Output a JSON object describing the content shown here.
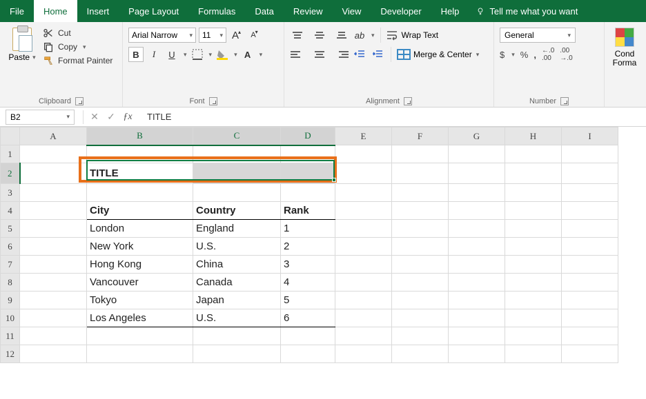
{
  "tabs": {
    "file": "File",
    "home": "Home",
    "insert": "Insert",
    "pageLayout": "Page Layout",
    "formulas": "Formulas",
    "data": "Data",
    "review": "Review",
    "view": "View",
    "developer": "Developer",
    "help": "Help",
    "tellMe": "Tell me what you want"
  },
  "ribbon": {
    "clipboard": {
      "paste": "Paste",
      "cut": "Cut",
      "copy": "Copy",
      "formatPainter": "Format Painter",
      "label": "Clipboard"
    },
    "font": {
      "name": "Arial Narrow",
      "size": "11",
      "label": "Font"
    },
    "alignment": {
      "wrap": "Wrap Text",
      "merge": "Merge & Center",
      "label": "Alignment"
    },
    "number": {
      "format": "General",
      "dollar": "$",
      "percent": "%",
      "comma": ",",
      "inc": ".0",
      "dec": ".00",
      "label": "Number"
    },
    "cond": {
      "line1": "Cond",
      "line2": "Forma"
    }
  },
  "formulaBar": {
    "nameBox": "B2",
    "formula": "TITLE"
  },
  "columns": [
    "A",
    "B",
    "C",
    "D",
    "E",
    "F",
    "G",
    "H",
    "I"
  ],
  "rows": [
    "1",
    "2",
    "3",
    "4",
    "5",
    "6",
    "7",
    "8",
    "9",
    "10",
    "11",
    "12"
  ],
  "cells": {
    "B2": "TITLE",
    "B4": "City",
    "C4": "Country",
    "D4": "Rank",
    "B5": "London",
    "C5": "England",
    "D5": "1",
    "B6": "New York",
    "C6": "U.S.",
    "D6": "2",
    "B7": "Hong Kong",
    "C7": "China",
    "D7": "3",
    "B8": "Vancouver",
    "C8": "Canada",
    "D8": "4",
    "B9": "Tokyo",
    "C9": "Japan",
    "D9": "5",
    "B10": "Los Angeles",
    "C10": "U.S.",
    "D10": "6"
  },
  "chart_data": {
    "type": "table",
    "title": "TITLE",
    "columns": [
      "City",
      "Country",
      "Rank"
    ],
    "rows": [
      [
        "London",
        "England",
        1
      ],
      [
        "New York",
        "U.S.",
        2
      ],
      [
        "Hong Kong",
        "China",
        3
      ],
      [
        "Vancouver",
        "Canada",
        4
      ],
      [
        "Tokyo",
        "Japan",
        5
      ],
      [
        "Los Angeles",
        "U.S.",
        6
      ]
    ]
  }
}
